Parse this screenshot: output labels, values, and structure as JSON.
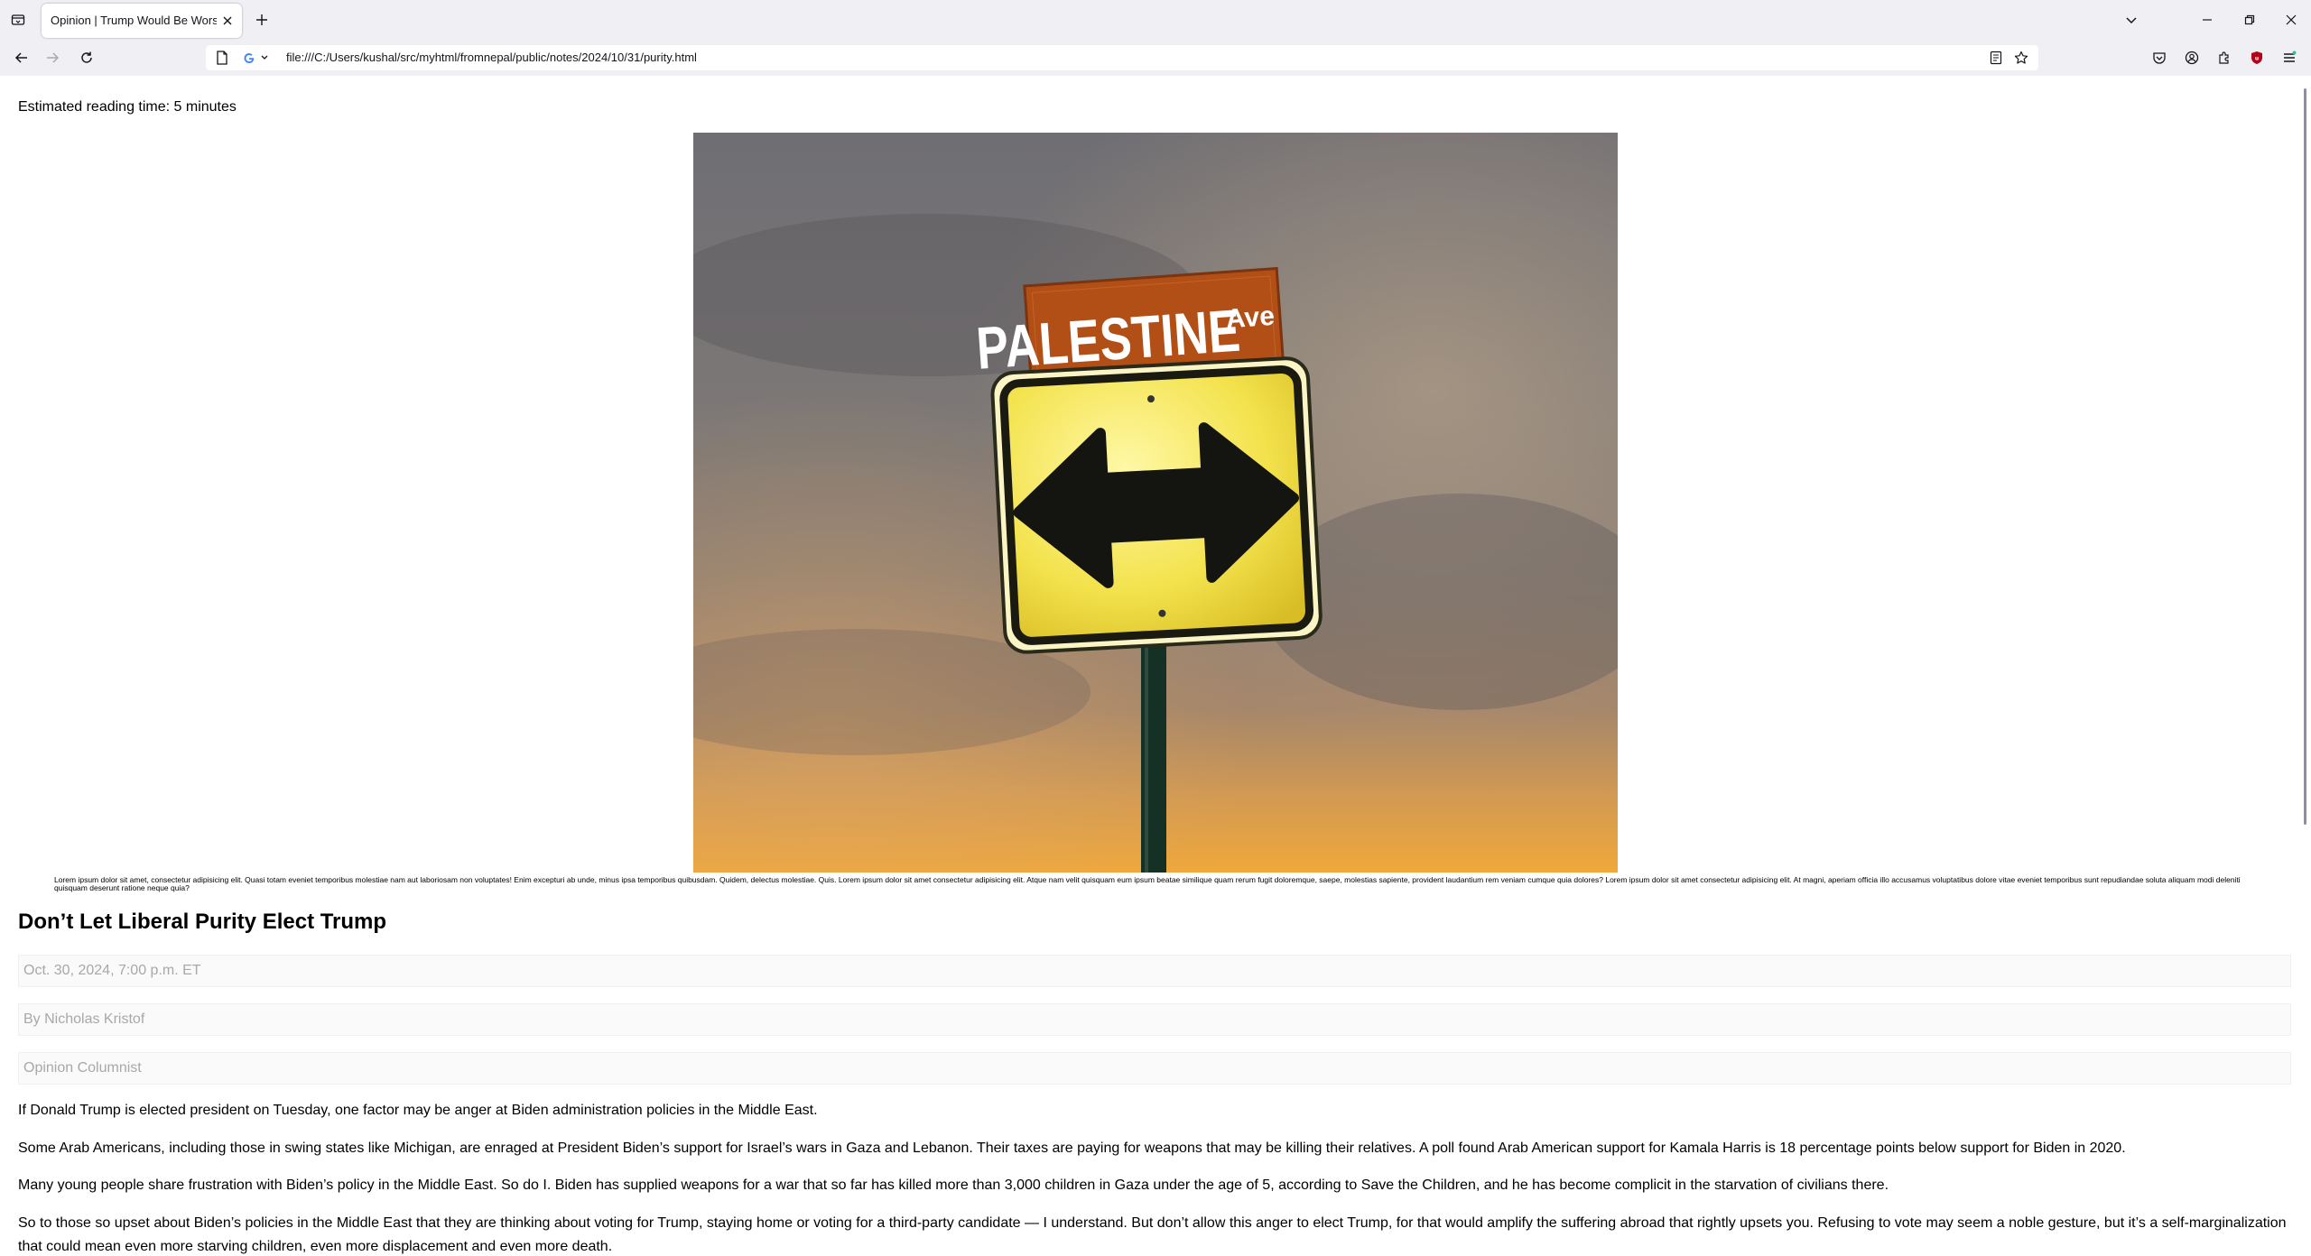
{
  "browser": {
    "tab": {
      "title": "Opinion | Trump Would Be Worse Than Biden on Gaza"
    },
    "url": "file:///C:/Users/kushal/src/myhtml/fromnepal/public/notes/2024/10/31/purity.html"
  },
  "page": {
    "reading_time": "Estimated reading time: 5 minutes",
    "image": {
      "street_sign": "PALESTINE",
      "street_suffix": "Ave"
    },
    "caption": "Lorem ipsum dolor sit amet, consectetur adipisicing elit. Quasi totam eveniet temporibus molestiae nam aut laboriosam non voluptates! Enim excepturi ab unde, minus ipsa temporibus quibusdam. Quidem, delectus molestiae. Quis. Lorem ipsum dolor sit amet consectetur adipisicing elit. Atque nam velit quisquam eum ipsum beatae similique quam rerum fugit doloremque, saepe, molestias sapiente, provident laudantium rem veniam cumque quia dolores? Lorem ipsum dolor sit amet consectetur adipisicing elit. At magni, aperiam officia illo accusamus voluptatibus dolore vitae eveniet temporibus sunt repudiandae soluta aliquam modi deleniti quisquam deserunt ratione neque quia?",
    "headline": "Don’t Let Liberal Purity Elect Trump",
    "date": "Oct. 30, 2024, 7:00 p.m. ET",
    "byline": "By Nicholas Kristof",
    "role": "Opinion Columnist",
    "paragraphs": [
      "If Donald Trump is elected president on Tuesday, one factor may be anger at Biden administration policies in the Middle East.",
      "Some Arab Americans, including those in swing states like Michigan, are enraged at President Biden’s support for Israel’s wars in Gaza and Lebanon. Their taxes are paying for weapons that may be killing their relatives. A poll found Arab American support for Kamala Harris is 18 percentage points below support for Biden in 2020.",
      "Many young people share frustration with Biden’s policy in the Middle East. So do I. Biden has supplied weapons for a war that so far has killed more than 3,000 children in Gaza under the age of 5, according to Save the Children, and he has become complicit in the starvation of civilians there.",
      "So to those so upset about Biden’s policies in the Middle East that they are thinking about voting for Trump, staying home or voting for a third-party candidate — I understand. But don’t allow this anger to elect Trump, for that would amplify the suffering abroad that rightly upsets you. Refusing to vote may seem a noble gesture, but it’s a self-marginalization that could mean even more starving children, even more displacement and even more death."
    ]
  },
  "colors": {
    "chrome_bg": "#f0f0f4",
    "meta_text": "#a8a8a8",
    "shield_red": "#b3001b"
  },
  "icons": [
    "tab-list-icon",
    "close-icon",
    "plus-icon",
    "chevron-down-icon",
    "minimize-icon",
    "restore-icon",
    "back-arrow-icon",
    "forward-arrow-icon",
    "reload-icon",
    "file-icon",
    "google-icon",
    "reader-view-icon",
    "bookmark-star-icon",
    "pocket-icon",
    "account-icon",
    "extensions-icon",
    "ublock-shield-icon",
    "app-menu-icon"
  ]
}
